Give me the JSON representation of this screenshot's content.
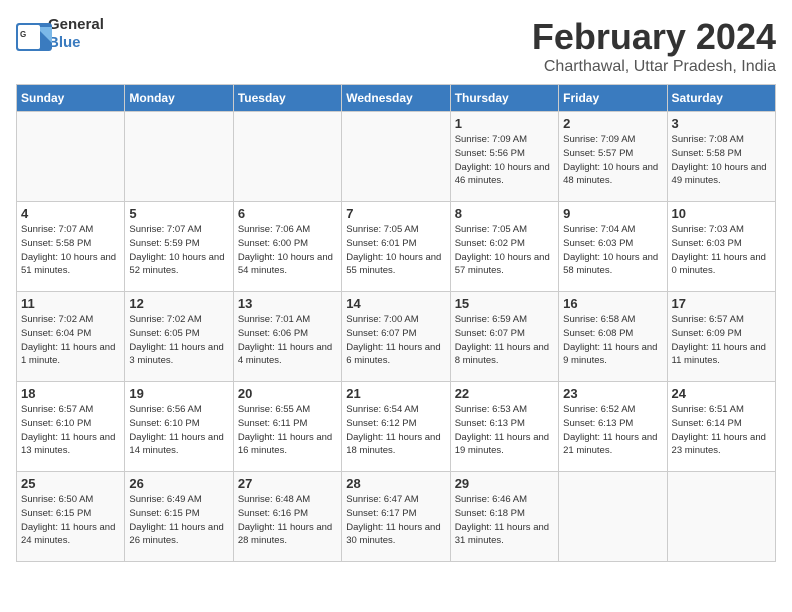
{
  "header": {
    "logo_general": "General",
    "logo_blue": "Blue",
    "month_title": "February 2024",
    "location": "Charthawal, Uttar Pradesh, India"
  },
  "days_of_week": [
    "Sunday",
    "Monday",
    "Tuesday",
    "Wednesday",
    "Thursday",
    "Friday",
    "Saturday"
  ],
  "weeks": [
    [
      {
        "day": "",
        "info": ""
      },
      {
        "day": "",
        "info": ""
      },
      {
        "day": "",
        "info": ""
      },
      {
        "day": "",
        "info": ""
      },
      {
        "day": "1",
        "info": "Sunrise: 7:09 AM\nSunset: 5:56 PM\nDaylight: 10 hours\nand 46 minutes."
      },
      {
        "day": "2",
        "info": "Sunrise: 7:09 AM\nSunset: 5:57 PM\nDaylight: 10 hours\nand 48 minutes."
      },
      {
        "day": "3",
        "info": "Sunrise: 7:08 AM\nSunset: 5:58 PM\nDaylight: 10 hours\nand 49 minutes."
      }
    ],
    [
      {
        "day": "4",
        "info": "Sunrise: 7:07 AM\nSunset: 5:58 PM\nDaylight: 10 hours\nand 51 minutes."
      },
      {
        "day": "5",
        "info": "Sunrise: 7:07 AM\nSunset: 5:59 PM\nDaylight: 10 hours\nand 52 minutes."
      },
      {
        "day": "6",
        "info": "Sunrise: 7:06 AM\nSunset: 6:00 PM\nDaylight: 10 hours\nand 54 minutes."
      },
      {
        "day": "7",
        "info": "Sunrise: 7:05 AM\nSunset: 6:01 PM\nDaylight: 10 hours\nand 55 minutes."
      },
      {
        "day": "8",
        "info": "Sunrise: 7:05 AM\nSunset: 6:02 PM\nDaylight: 10 hours\nand 57 minutes."
      },
      {
        "day": "9",
        "info": "Sunrise: 7:04 AM\nSunset: 6:03 PM\nDaylight: 10 hours\nand 58 minutes."
      },
      {
        "day": "10",
        "info": "Sunrise: 7:03 AM\nSunset: 6:03 PM\nDaylight: 11 hours\nand 0 minutes."
      }
    ],
    [
      {
        "day": "11",
        "info": "Sunrise: 7:02 AM\nSunset: 6:04 PM\nDaylight: 11 hours\nand 1 minute."
      },
      {
        "day": "12",
        "info": "Sunrise: 7:02 AM\nSunset: 6:05 PM\nDaylight: 11 hours\nand 3 minutes."
      },
      {
        "day": "13",
        "info": "Sunrise: 7:01 AM\nSunset: 6:06 PM\nDaylight: 11 hours\nand 4 minutes."
      },
      {
        "day": "14",
        "info": "Sunrise: 7:00 AM\nSunset: 6:07 PM\nDaylight: 11 hours\nand 6 minutes."
      },
      {
        "day": "15",
        "info": "Sunrise: 6:59 AM\nSunset: 6:07 PM\nDaylight: 11 hours\nand 8 minutes."
      },
      {
        "day": "16",
        "info": "Sunrise: 6:58 AM\nSunset: 6:08 PM\nDaylight: 11 hours\nand 9 minutes."
      },
      {
        "day": "17",
        "info": "Sunrise: 6:57 AM\nSunset: 6:09 PM\nDaylight: 11 hours\nand 11 minutes."
      }
    ],
    [
      {
        "day": "18",
        "info": "Sunrise: 6:57 AM\nSunset: 6:10 PM\nDaylight: 11 hours\nand 13 minutes."
      },
      {
        "day": "19",
        "info": "Sunrise: 6:56 AM\nSunset: 6:10 PM\nDaylight: 11 hours\nand 14 minutes."
      },
      {
        "day": "20",
        "info": "Sunrise: 6:55 AM\nSunset: 6:11 PM\nDaylight: 11 hours\nand 16 minutes."
      },
      {
        "day": "21",
        "info": "Sunrise: 6:54 AM\nSunset: 6:12 PM\nDaylight: 11 hours\nand 18 minutes."
      },
      {
        "day": "22",
        "info": "Sunrise: 6:53 AM\nSunset: 6:13 PM\nDaylight: 11 hours\nand 19 minutes."
      },
      {
        "day": "23",
        "info": "Sunrise: 6:52 AM\nSunset: 6:13 PM\nDaylight: 11 hours\nand 21 minutes."
      },
      {
        "day": "24",
        "info": "Sunrise: 6:51 AM\nSunset: 6:14 PM\nDaylight: 11 hours\nand 23 minutes."
      }
    ],
    [
      {
        "day": "25",
        "info": "Sunrise: 6:50 AM\nSunset: 6:15 PM\nDaylight: 11 hours\nand 24 minutes."
      },
      {
        "day": "26",
        "info": "Sunrise: 6:49 AM\nSunset: 6:15 PM\nDaylight: 11 hours\nand 26 minutes."
      },
      {
        "day": "27",
        "info": "Sunrise: 6:48 AM\nSunset: 6:16 PM\nDaylight: 11 hours\nand 28 minutes."
      },
      {
        "day": "28",
        "info": "Sunrise: 6:47 AM\nSunset: 6:17 PM\nDaylight: 11 hours\nand 30 minutes."
      },
      {
        "day": "29",
        "info": "Sunrise: 6:46 AM\nSunset: 6:18 PM\nDaylight: 11 hours\nand 31 minutes."
      },
      {
        "day": "",
        "info": ""
      },
      {
        "day": "",
        "info": ""
      }
    ]
  ]
}
